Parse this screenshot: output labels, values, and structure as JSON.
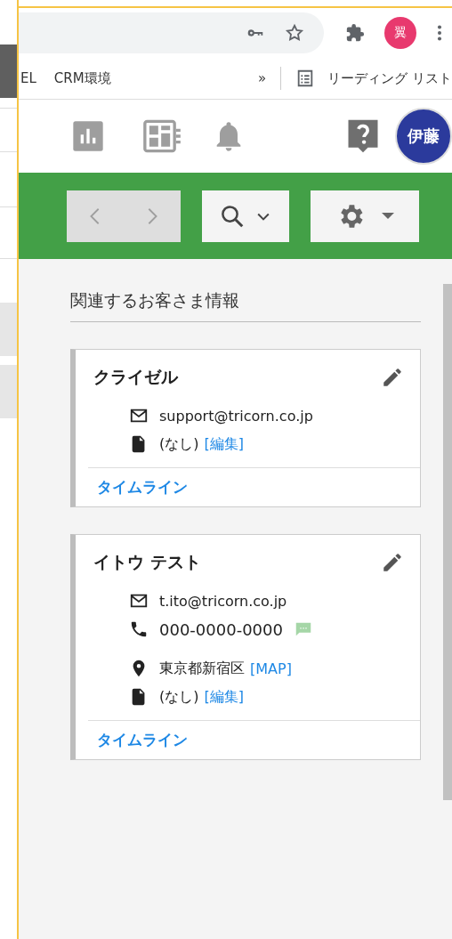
{
  "browser": {
    "profile_initial": "翼",
    "bookmarks": [
      "EL",
      "CRM環境"
    ],
    "bookmarks_overflow": "»",
    "reading_list": "リーディング リスト"
  },
  "app_header": {
    "user_initials": "伊藤"
  },
  "section_title": "関連するお客さま情報",
  "customers": [
    {
      "name": "クライゼル",
      "details": [
        {
          "kind": "email",
          "text": "support@tricorn.co.jp"
        },
        {
          "kind": "note",
          "text": "(なし)",
          "link": "[編集]"
        }
      ],
      "footer_link": "タイムライン"
    },
    {
      "name": "イトウ テスト",
      "details": [
        {
          "kind": "email",
          "text": "t.ito@tricorn.co.jp"
        },
        {
          "kind": "phone",
          "text": "000-0000-0000"
        },
        {
          "kind": "address",
          "text": "東京都新宿区",
          "link": "[MAP]"
        },
        {
          "kind": "note",
          "text": "(なし)",
          "link": "[編集]"
        }
      ],
      "footer_link": "タイムライン"
    }
  ]
}
